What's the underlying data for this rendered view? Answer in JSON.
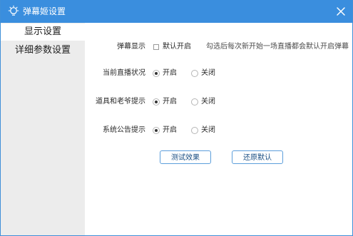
{
  "window": {
    "title": "弹幕姬设置",
    "icon": "lightbulb-icon",
    "close_icon": "close-icon"
  },
  "sidebar": {
    "items": [
      {
        "label": "显示设置",
        "active": true
      },
      {
        "label": "详细参数设置",
        "active": false
      }
    ]
  },
  "settings": {
    "barrage_display": {
      "label": "弹幕显示",
      "option_label": "默认开启",
      "checked": false,
      "hint": "勾选后每次新开始一场直播都会默认开启弹幕"
    },
    "live_status": {
      "label": "当前直播状况",
      "on_label": "开启",
      "off_label": "关闭",
      "selected": "开启"
    },
    "props_hint": {
      "label": "道具和老爷提示",
      "on_label": "开启",
      "off_label": "关闭",
      "selected": "开启"
    },
    "system_notice": {
      "label": "系统公告提示",
      "on_label": "开启",
      "off_label": "关闭",
      "selected": "开启"
    }
  },
  "actions": {
    "test_label": "测试效果",
    "restore_label": "还原默认"
  },
  "colors": {
    "titlebar": "#3a8ede",
    "sidebar": "#ececec",
    "button_border": "#5c9edb"
  }
}
